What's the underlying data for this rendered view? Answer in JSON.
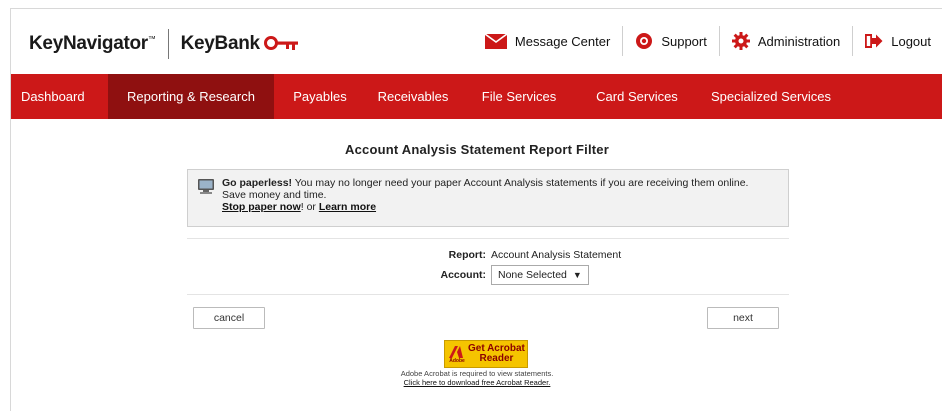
{
  "header": {
    "brand_nav": "KeyNavigator",
    "brand_tm": "™",
    "brand_bank": "KeyBank",
    "topnav": [
      {
        "label": "Message Center",
        "icon": "envelope-icon"
      },
      {
        "label": "Support",
        "icon": "lifebuoy-icon"
      },
      {
        "label": "Administration",
        "icon": "gear-icon"
      },
      {
        "label": "Logout",
        "icon": "logout-icon"
      }
    ]
  },
  "nav": {
    "items": [
      {
        "label": "Dashboard"
      },
      {
        "label": "Reporting & Research"
      },
      {
        "label": "Payables"
      },
      {
        "label": "Receivables"
      },
      {
        "label": "File Services"
      },
      {
        "label": "Card Services"
      },
      {
        "label": "Specialized Services"
      }
    ]
  },
  "main": {
    "title": "Account Analysis Statement Report Filter",
    "notice": {
      "headline": "Go paperless!",
      "body": " You may no longer need your paper Account Analysis statements if you are receiving them online.",
      "body2": "Save money and time.",
      "link1": "Stop paper now",
      "between": "! or ",
      "link2": "Learn more"
    },
    "report_label": "Report:",
    "report_value": "Account Analysis Statement",
    "account_label": "Account:",
    "account_value": "None Selected",
    "cancel_label": "cancel",
    "next_label": "next"
  },
  "acrobat": {
    "badge_line1": "Get Acrobat",
    "badge_line2": "Reader",
    "brand": "Adobe",
    "note": "Adobe Acrobat is required to view statements.",
    "link": "Click here to download free Acrobat Reader."
  },
  "colors": {
    "brand_red": "#cc1818",
    "active_nav": "#8f1010"
  }
}
